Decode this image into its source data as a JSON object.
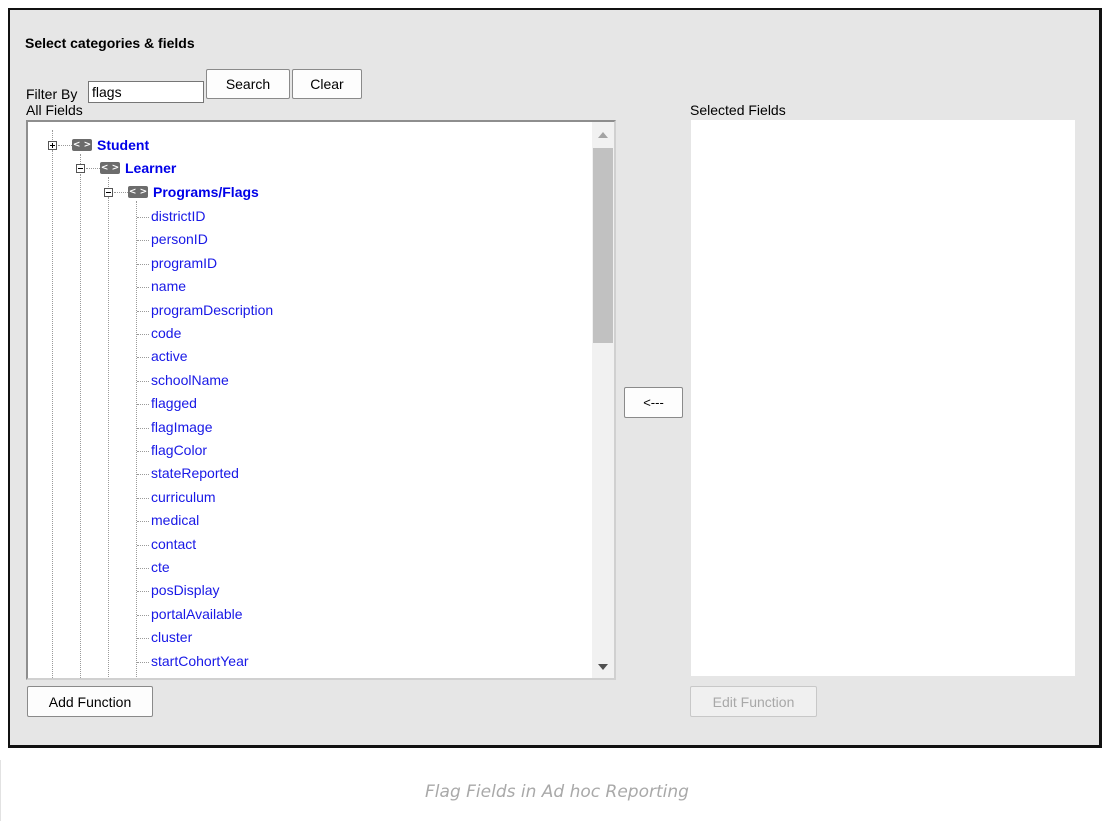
{
  "panel": {
    "title": "Select categories & fields",
    "filter_label": "Filter By",
    "filter_value": "flags",
    "search_label": "Search",
    "clear_label": "Clear",
    "all_fields_label": "All Fields",
    "selected_fields_label": "Selected Fields",
    "move_left_label": "<---",
    "add_function_label": "Add Function",
    "edit_function_label": "Edit Function"
  },
  "tree": {
    "tag_icon_text": "< >",
    "student": "Student",
    "learner": "Learner",
    "programs": "Programs/Flags",
    "fields": [
      "districtID",
      "personID",
      "programID",
      "name",
      "programDescription",
      "code",
      "active",
      "schoolName",
      "flagged",
      "flagImage",
      "flagColor",
      "stateReported",
      "curriculum",
      "medical",
      "contact",
      "cte",
      "posDisplay",
      "portalAvailable",
      "cluster",
      "startCohortYear"
    ]
  },
  "caption": "Flag Fields in Ad hoc Reporting",
  "colors": {
    "link": "#1818e6",
    "panel_bg": "#e6e6e6",
    "caption": "#a9a9a9"
  },
  "icons": {
    "expand": "plus-box-icon",
    "collapse": "minus-box-icon",
    "node": "xml-tag-icon"
  }
}
